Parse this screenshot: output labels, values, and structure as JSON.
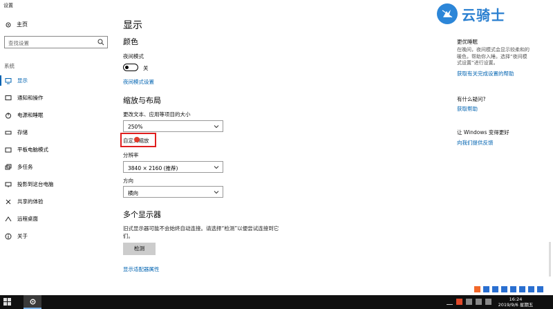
{
  "window": {
    "title": "设置"
  },
  "sidebar": {
    "home_label": "主页",
    "search_placeholder": "查找设置",
    "section_label": "系统",
    "items": [
      {
        "label": "显示",
        "icon": "monitor-icon",
        "active": true
      },
      {
        "label": "通知和操作",
        "icon": "notification-icon"
      },
      {
        "label": "电源和睡眠",
        "icon": "power-icon"
      },
      {
        "label": "存储",
        "icon": "storage-icon"
      },
      {
        "label": "平板电脑模式",
        "icon": "tablet-icon"
      },
      {
        "label": "多任务",
        "icon": "multitask-icon"
      },
      {
        "label": "投影到这台电脑",
        "icon": "project-icon"
      },
      {
        "label": "共享的体验",
        "icon": "share-icon"
      },
      {
        "label": "远程桌面",
        "icon": "remote-icon"
      },
      {
        "label": "关于",
        "icon": "info-icon"
      }
    ]
  },
  "main": {
    "title": "显示",
    "color": {
      "heading": "颜色",
      "night_light_label": "夜间模式",
      "night_light_state": "关",
      "night_light_settings_link": "夜间模式设置"
    },
    "scale": {
      "heading": "缩放与布局",
      "size_label": "更改文本、应用等项目的大小",
      "size_value": "250%",
      "custom_scaling_link": "自定义缩放",
      "resolution_label": "分辨率",
      "resolution_value": "3840 × 2160 (推荐)",
      "orientation_label": "方向",
      "orientation_value": "横向"
    },
    "multi": {
      "heading": "多个显示器",
      "description": "旧式显示器可能不会始终自动连接。请选择“检测”以便尝试连接到它们。",
      "detect_button": "检测",
      "adapter_link": "显示适配器属性"
    }
  },
  "right_panel": {
    "sleep_heading": "更优睡眠",
    "sleep_text": "在晚间，夜间模式会显示较柔和的暖色，帮助你入睡。选择“夜间模式设置”进行设置。",
    "sleep_link": "获取有关完成设置的帮助",
    "question_heading": "有什么疑问?",
    "help_link": "获取帮助",
    "improve_heading": "让 Windows 变得更好",
    "feedback_link": "向我们提供反馈"
  },
  "watermark": {
    "text": "云骑士"
  },
  "taskbar": {
    "time": "16:24",
    "date": "2019/9/6 星期五"
  },
  "colors": {
    "accent": "#0063b1",
    "highlight_box": "#e01e1e",
    "taskbar": "#101010"
  }
}
